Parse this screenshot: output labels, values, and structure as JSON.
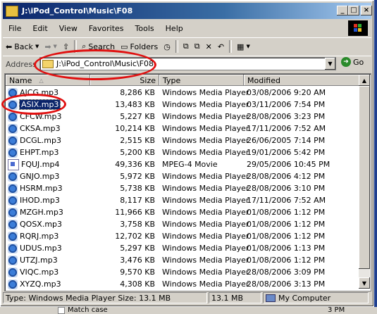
{
  "window": {
    "title": "J:\\iPod_Control\\Music\\F08"
  },
  "menu": [
    "File",
    "Edit",
    "View",
    "Favorites",
    "Tools",
    "Help"
  ],
  "toolbar": {
    "back": "Back",
    "search": "Search",
    "folders": "Folders"
  },
  "address": {
    "label": "Address",
    "path": "J:\\iPod_Control\\Music\\F08",
    "go": "Go"
  },
  "columns": {
    "name": "Name",
    "size": "Size",
    "type": "Type",
    "modified": "Modified"
  },
  "files": [
    {
      "name": "AJCG.mp3",
      "size": "8,286 KB",
      "type": "Windows Media Player",
      "modified": "03/08/2006 9:20 AM",
      "icon": "media-player-icon"
    },
    {
      "name": "ASIX.mp3",
      "size": "13,483 KB",
      "type": "Windows Media Player",
      "modified": "03/11/2006 7:54 PM",
      "icon": "media-player-icon",
      "selected": true
    },
    {
      "name": "CFCW.mp3",
      "size": "5,227 KB",
      "type": "Windows Media Player",
      "modified": "28/08/2006 3:23 PM",
      "icon": "media-player-icon"
    },
    {
      "name": "CKSA.mp3",
      "size": "10,214 KB",
      "type": "Windows Media Player",
      "modified": "17/11/2006 7:52 AM",
      "icon": "media-player-icon"
    },
    {
      "name": "DCGL.mp3",
      "size": "2,515 KB",
      "type": "Windows Media Player",
      "modified": "26/06/2005 7:14 PM",
      "icon": "media-player-icon"
    },
    {
      "name": "EHPT.mp3",
      "size": "5,200 KB",
      "type": "Windows Media Player",
      "modified": "19/01/2006 5:42 PM",
      "icon": "media-player-icon"
    },
    {
      "name": "FQUJ.mp4",
      "size": "49,336 KB",
      "type": "MPEG-4 Movie",
      "modified": "29/05/2006 10:45 PM",
      "icon": "movie-icon"
    },
    {
      "name": "GNJO.mp3",
      "size": "5,972 KB",
      "type": "Windows Media Player",
      "modified": "28/08/2006 4:12 PM",
      "icon": "media-player-icon"
    },
    {
      "name": "HSRM.mp3",
      "size": "5,738 KB",
      "type": "Windows Media Player",
      "modified": "28/08/2006 3:10 PM",
      "icon": "media-player-icon"
    },
    {
      "name": "IHOD.mp3",
      "size": "8,117 KB",
      "type": "Windows Media Player",
      "modified": "17/11/2006 7:52 AM",
      "icon": "media-player-icon"
    },
    {
      "name": "MZGH.mp3",
      "size": "11,966 KB",
      "type": "Windows Media Player",
      "modified": "01/08/2006 1:12 PM",
      "icon": "media-player-icon"
    },
    {
      "name": "QOSX.mp3",
      "size": "3,758 KB",
      "type": "Windows Media Player",
      "modified": "01/08/2006 1:12 PM",
      "icon": "media-player-icon"
    },
    {
      "name": "RQRJ.mp3",
      "size": "12,702 KB",
      "type": "Windows Media Player",
      "modified": "01/08/2006 1:12 PM",
      "icon": "media-player-icon"
    },
    {
      "name": "UDUS.mp3",
      "size": "5,297 KB",
      "type": "Windows Media Player",
      "modified": "01/08/2006 1:13 PM",
      "icon": "media-player-icon"
    },
    {
      "name": "UTZJ.mp3",
      "size": "3,476 KB",
      "type": "Windows Media Player",
      "modified": "01/08/2006 1:12 PM",
      "icon": "media-player-icon"
    },
    {
      "name": "VIQC.mp3",
      "size": "9,570 KB",
      "type": "Windows Media Player",
      "modified": "28/08/2006 3:09 PM",
      "icon": "media-player-icon"
    },
    {
      "name": "XYZQ.mp3",
      "size": "4,308 KB",
      "type": "Windows Media Player",
      "modified": "28/08/2006 3:13 PM",
      "icon": "media-player-icon"
    }
  ],
  "status": {
    "info": "Type: Windows Media Player Size: 13.1 MB",
    "size": "13.1 MB",
    "zone": "My Computer"
  },
  "below": {
    "match_case": "Match case",
    "time": "3 PM"
  },
  "colors": {
    "title_start": "#0a246a",
    "title_end": "#a6caf0",
    "selection": "#0a246a",
    "annotation": "#e01010"
  }
}
